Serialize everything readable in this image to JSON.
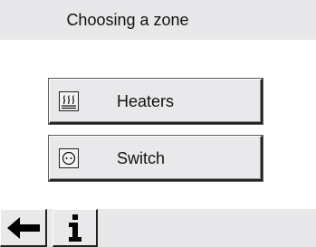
{
  "header": {
    "title": "Choosing a zone"
  },
  "zones": [
    {
      "label": "Heaters",
      "icon": "heater-icon"
    },
    {
      "label": "Switch",
      "icon": "socket-icon"
    }
  ],
  "footer": {
    "back_icon": "arrow-left-icon",
    "info_icon": "info-icon"
  }
}
